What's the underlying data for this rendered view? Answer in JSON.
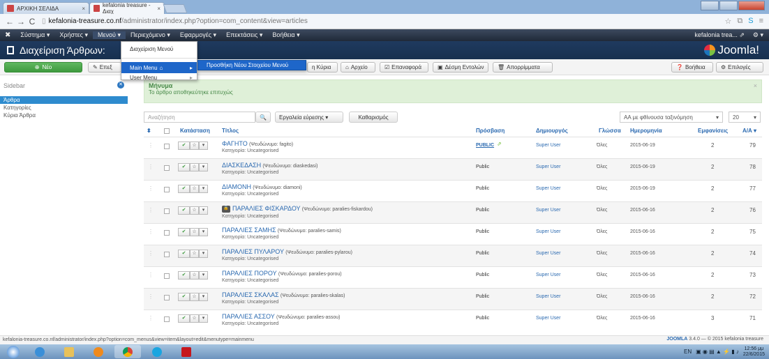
{
  "browser": {
    "tabs": [
      {
        "label": "ΑΡΧΙΚΗ ΣΕΛΙΔΑ",
        "close": "×"
      },
      {
        "label": "kefalonia treasure - Διαχ",
        "close": "×"
      }
    ],
    "url_host": "kefalonia-treasure.co.nf",
    "url_path": "/administrator/index.php?option=com_content&view=articles"
  },
  "topnav": {
    "items": [
      "Σύστημα ▾",
      "Χρήστες ▾",
      "Μενού ▾",
      "Περιεχόμενο ▾",
      "Εφαρμογές ▾",
      "Επεκτάσεις ▾",
      "Βοήθεια ▾"
    ],
    "site_link": "kefalonia trea... ⇗",
    "gear": "⚙ ▾"
  },
  "header": {
    "title": "Διαχείριση Άρθρων:",
    "logo": "Joomla!"
  },
  "menu_dropdown": {
    "items": [
      "Διαχείριση Μενού",
      "Main Menu",
      "User Menu"
    ],
    "submenu": "Προσθήκη Νέου Στοιχείου Μενού"
  },
  "toolbar": {
    "new": "Νέο",
    "edit": "Επεξ",
    "frontpage": "η Κύρια",
    "archive": "Αρχείο",
    "restore": "Επαναφορά",
    "batch": "Δέσμη Εντολών",
    "trash": "Απορρίμματα",
    "help": "Βοήθεια",
    "options": "Επιλογές"
  },
  "sidebar": {
    "header": "Sidebar",
    "items": [
      "Άρθρα",
      "Κατηγορίες",
      "Κύρια Άρθρα"
    ]
  },
  "message": {
    "heading": "Μήνυμα",
    "body": "Το άρθρο αποθηκεύτηκε επιτυχώς",
    "close": "×"
  },
  "filters": {
    "search_placeholder": "Αναζήτηση",
    "search_tools": "Εργαλεία εύρεσης ▾",
    "clear": "Καθαρισμός",
    "sort": "ΑΑ με φθίνουσα ταξινόμηση",
    "limit": "20"
  },
  "table": {
    "headers": {
      "order": "⬍",
      "status": "Κατάσταση",
      "title": "Τίτλος",
      "access": "Πρόσβαση",
      "author": "Δημιουργός",
      "language": "Γλώσσα",
      "date": "Ημερομηνία",
      "hits": "Εμφανίσεις",
      "id": "Α/Α ▾"
    },
    "rows": [
      {
        "title": "ΦΑΓΗΤΟ",
        "alias": "(Ψευδώνυμο: fagito)",
        "category": "Κατηγορία: Uncategorised",
        "access": "PUBLIC",
        "author": "Super User",
        "language": "Όλες",
        "date": "2015-06-19",
        "hits": "2",
        "id": "79"
      },
      {
        "title": "ΔΙΑΣΚΕΔΑΣΗ",
        "alias": "(Ψευδώνυμο: diaskedasi)",
        "category": "Κατηγορία: Uncategorised",
        "access": "Public",
        "author": "Super User",
        "language": "Όλες",
        "date": "2015-06-19",
        "hits": "2",
        "id": "78"
      },
      {
        "title": "ΔΙΑΜΟΝΗ",
        "alias": "(Ψευδώνυμο: diamoni)",
        "category": "Κατηγορία: Uncategorised",
        "access": "Public",
        "author": "Super User",
        "language": "Όλες",
        "date": "2015-06-19",
        "hits": "2",
        "id": "77"
      },
      {
        "title": "ΠΑΡΑΛΙΕΣ ΦΙΣΚΑΡΔΟΥ",
        "alias": "(Ψευδώνυμο: paralies-fiskardou)",
        "category": "Κατηγορία: Uncategorised",
        "access": "Public",
        "author": "Super User",
        "language": "Όλες",
        "date": "2015-06-16",
        "hits": "2",
        "id": "76",
        "locked": true
      },
      {
        "title": "ΠΑΡΑΛΙΕΣ ΣΑΜΗΣ",
        "alias": "(Ψευδώνυμο: paralies-samis)",
        "category": "Κατηγορία: Uncategorised",
        "access": "Public",
        "author": "Super User",
        "language": "Όλες",
        "date": "2015-06-16",
        "hits": "2",
        "id": "75"
      },
      {
        "title": "ΠΑΡΑΛΙΕΣ ΠΥΛΑΡΟΥ",
        "alias": "(Ψευδώνυμο: paralies-pylarou)",
        "category": "Κατηγορία: Uncategorised",
        "access": "Public",
        "author": "Super User",
        "language": "Όλες",
        "date": "2015-06-16",
        "hits": "2",
        "id": "74"
      },
      {
        "title": "ΠΑΡΑΛΙΕΣ ΠΟΡΟΥ",
        "alias": "(Ψευδώνυμο: paralies-porou)",
        "category": "Κατηγορία: Uncategorised",
        "access": "Public",
        "author": "Super User",
        "language": "Όλες",
        "date": "2015-06-16",
        "hits": "2",
        "id": "73"
      },
      {
        "title": "ΠΑΡΑΛΙΕΣ ΣΚΑΛΑΣ",
        "alias": "(Ψευδώνυμο: paralies-skalas)",
        "category": "Κατηγορία: Uncategorised",
        "access": "Public",
        "author": "Super User",
        "language": "Όλες",
        "date": "2015-06-16",
        "hits": "2",
        "id": "72"
      },
      {
        "title": "ΠΑΡΑΛΙΕΣ ΑΣΣΟΥ",
        "alias": "(Ψευδώνυμο: paralies-assou)",
        "category": "Κατηγορία: Uncategorised",
        "access": "Public",
        "author": "Super User",
        "language": "Όλες",
        "date": "2015-06-16",
        "hits": "3",
        "id": "71"
      }
    ]
  },
  "statusbar": {
    "url": "kefalonia-treasure.co.nf/administrator/index.php?option=com_menus&view=item&layout=edit&menutype=mainmenu",
    "brand": "JOOMLA",
    "version": "3.4.0 — © 2015 kefalonia treasure"
  },
  "taskbar": {
    "lang": "EN",
    "time": "12:56 μμ",
    "date": "22/6/2015"
  },
  "colors": {
    "accent": "#2a69b0",
    "success_bg": "#dff0d8",
    "nav_bg": "#1f2938"
  }
}
